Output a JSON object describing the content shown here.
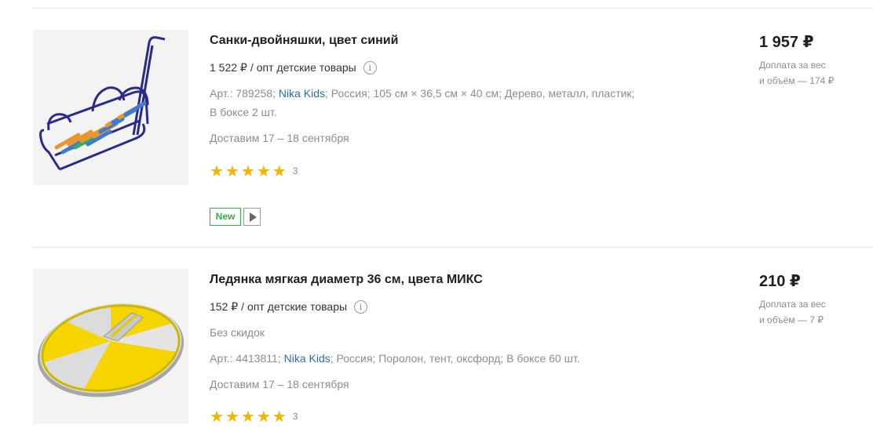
{
  "products": [
    {
      "title": "Санки-двойняшки, цвет синий",
      "wholesale_price": "1 522 ₽",
      "wholesale_sep": "/",
      "wholesale_label": "опт детские товары",
      "info_glyph": "i",
      "article": "Арт.: 789258;",
      "brand": "Nika Kids",
      "specs_rest": "; Россия; 105 см × 36,5 см × 40 см; Дерево, металл, пластик;",
      "specs_line2": "В боксе 2 шт.",
      "delivery": "Доставим 17 – 18 сентября",
      "rating": 5,
      "rating_count": "3",
      "badge_new": "New",
      "price": "1 957 ₽",
      "surcharge_line1": "Доплата за вес",
      "surcharge_line2": "и объём — 174 ₽",
      "image_icon": "sled-image"
    },
    {
      "title": "Ледянка мягкая диаметр 36 см, цвета МИКС",
      "wholesale_price": "152 ₽",
      "wholesale_sep": "/",
      "wholesale_label": "опт детские товары",
      "info_glyph": "i",
      "discount": "Без скидок",
      "article": "Арт.: 4413811;",
      "brand": "Nika Kids",
      "specs_rest": "; Россия; Поролон, тент, оксфорд; В боксе 60 шт.",
      "delivery": "Доставим 17 – 18 сентября",
      "rating": 5,
      "rating_count": "3",
      "price": "210 ₽",
      "surcharge_line1": "Доплата за вес",
      "surcharge_line2": "и объём — 7 ₽",
      "image_icon": "ice-slide-image"
    }
  ],
  "colors": {
    "brand_link": "#2b6cb0",
    "star": "#f5b400",
    "badge_new": "#2eb34a"
  }
}
